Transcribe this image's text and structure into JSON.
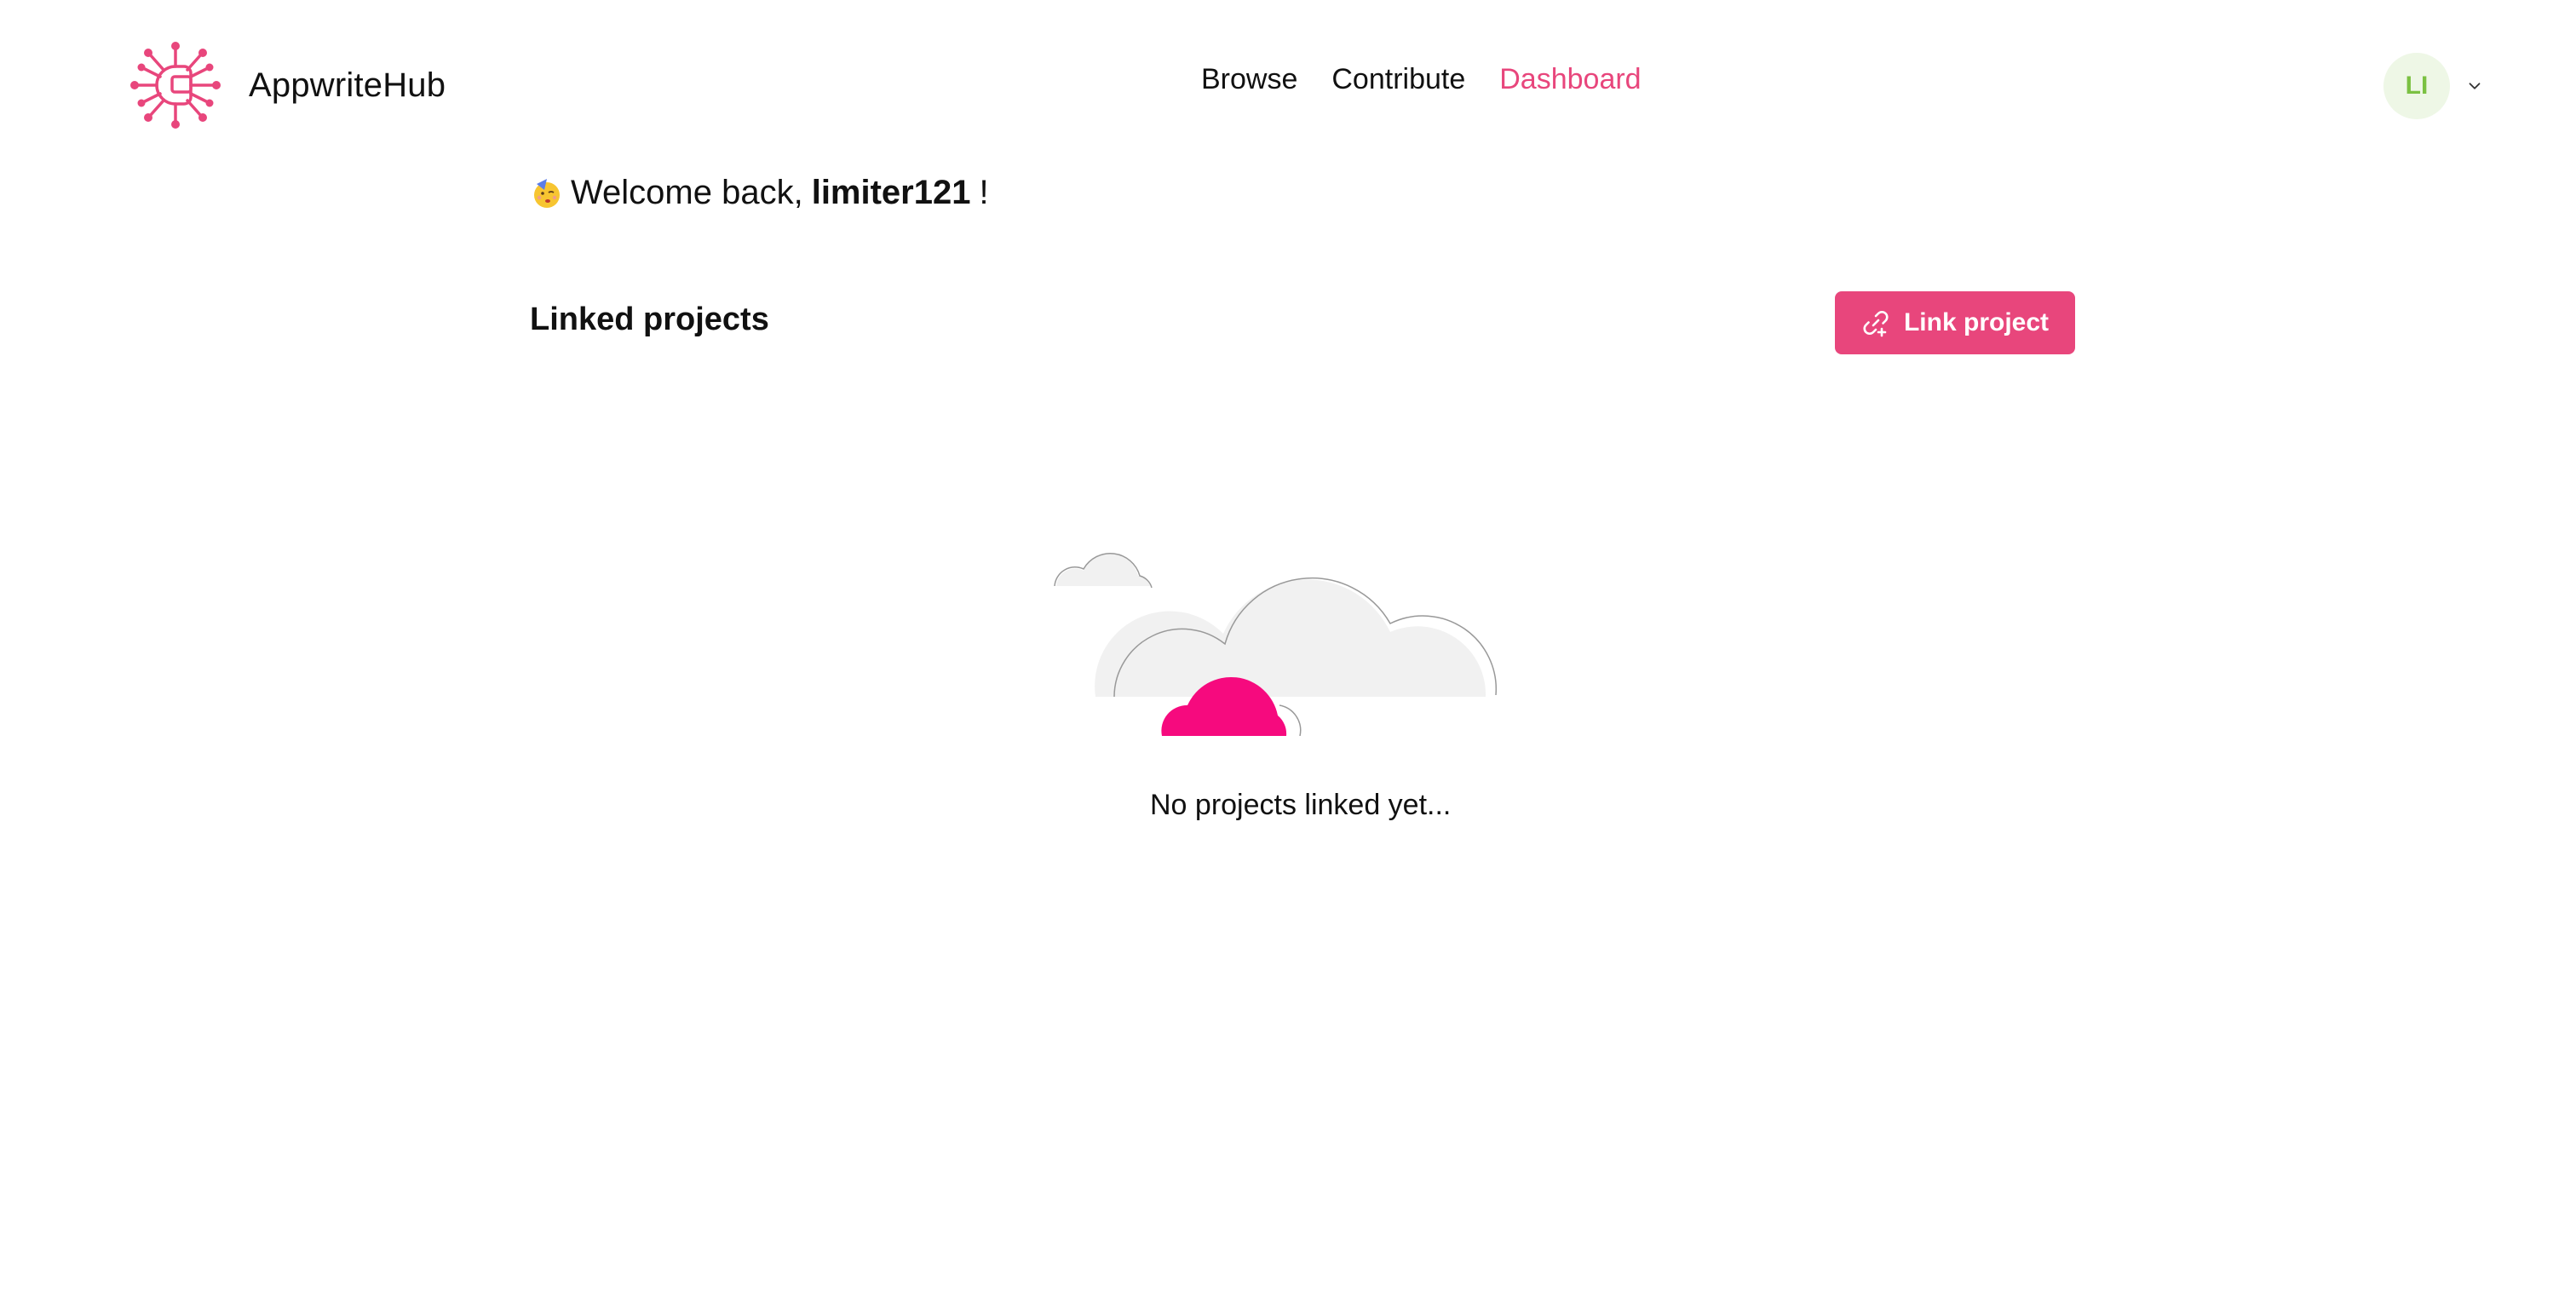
{
  "brand": {
    "name": "AppwriteHub",
    "logo_icon": "circuit-brain-logo",
    "accent_color": "#e8467c"
  },
  "nav": {
    "items": [
      {
        "label": "Browse",
        "active": false
      },
      {
        "label": "Contribute",
        "active": false
      },
      {
        "label": "Dashboard",
        "active": true
      }
    ]
  },
  "user": {
    "initials": "LI",
    "avatar_bg": "#eef7e6",
    "avatar_fg": "#7bc142",
    "menu_icon": "chevron-down-icon"
  },
  "welcome": {
    "emoji_icon": "party-face-icon",
    "prefix": "Welcome back,",
    "username": "limiter121",
    "suffix": "!"
  },
  "projects": {
    "title": "Linked projects",
    "link_button_label": "Link project",
    "link_button_icon": "link-add-icon",
    "empty_illustration": "clouds-icon",
    "empty_message": "No projects linked yet..."
  }
}
